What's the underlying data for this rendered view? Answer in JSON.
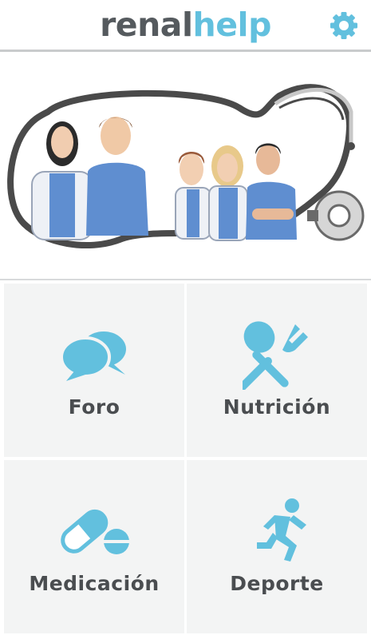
{
  "app": {
    "logo_part1": "renal",
    "logo_part2": "help",
    "brand_color": "#62c0de",
    "text_color": "#555a5e",
    "settings_icon": "gear-icon"
  },
  "hero": {
    "illustration": "doctors-with-stethoscope"
  },
  "menu": {
    "items": [
      {
        "label": "Foro",
        "icon": "chat-bubbles-icon"
      },
      {
        "label": "Nutrición",
        "icon": "spoon-fork-icon"
      },
      {
        "label": "Medicación",
        "icon": "pill-icon"
      },
      {
        "label": "Deporte",
        "icon": "runner-icon"
      }
    ]
  }
}
